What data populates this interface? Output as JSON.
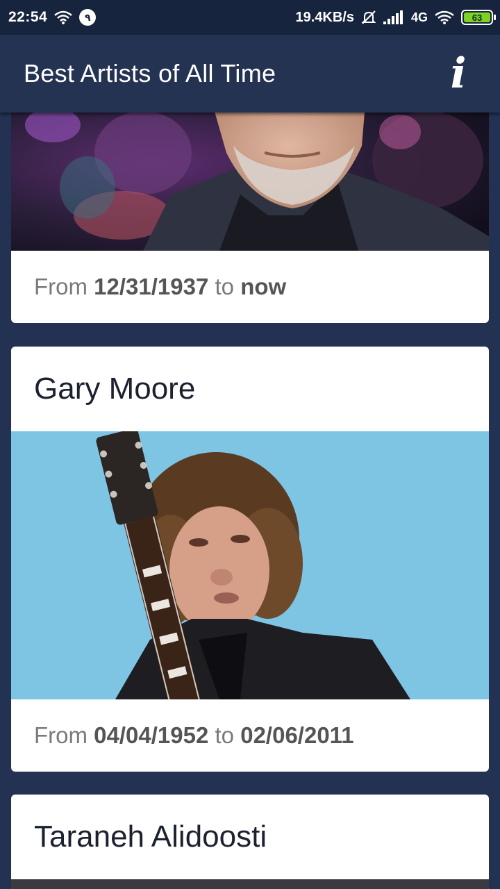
{
  "status_bar": {
    "time": "22:54",
    "notification_count": "٩",
    "network_speed": "19.4KB/s",
    "network_type": "4G",
    "battery": "63"
  },
  "app_bar": {
    "title": "Best Artists of All Time",
    "info_label": "i"
  },
  "artists": [
    {
      "name": "",
      "from_label": "From",
      "birth": "12/31/1937",
      "to_label": "to",
      "death": "now"
    },
    {
      "name": "Gary Moore",
      "from_label": "From",
      "birth": "04/04/1952",
      "to_label": "to",
      "death": "02/06/2011"
    },
    {
      "name": "Taraneh Alidoosti"
    }
  ],
  "colors": {
    "background": "#233253",
    "status_bar": "#17243d",
    "app_bar": "#243352",
    "card": "#ffffff",
    "battery": "#7ed321"
  }
}
